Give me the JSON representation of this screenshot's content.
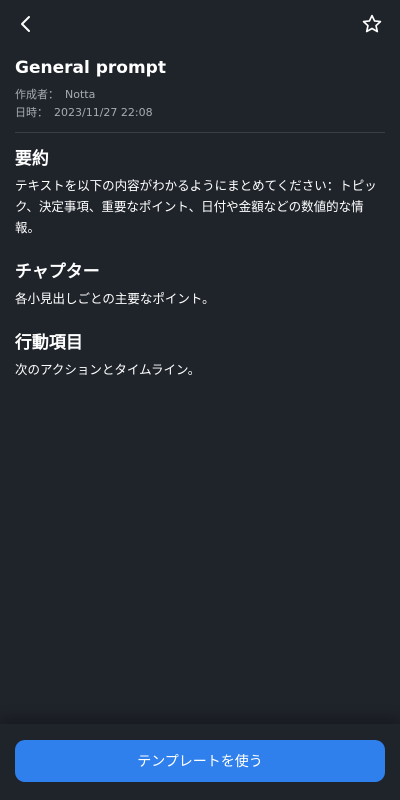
{
  "header": {
    "back_icon": "back-arrow-icon",
    "favorite_icon": "star-outline-icon"
  },
  "template": {
    "title": "General prompt",
    "author_label": "作成者：",
    "author_value": "Notta",
    "date_label": "日時：",
    "date_value": "2023/11/27 22:08"
  },
  "sections": [
    {
      "heading": "要約",
      "body": "テキストを以下の内容がわかるようにまとめてください：トピック、決定事項、重要なポイント、日付や金額などの数値的な情報。"
    },
    {
      "heading": "チャプター",
      "body": "各小見出しごとの主要なポイント。"
    },
    {
      "heading": "行動項目",
      "body": "次のアクションとタイムライン。"
    }
  ],
  "footer": {
    "use_template_label": "テンプレートを使う"
  },
  "colors": {
    "background": "#1f232a",
    "accent": "#2f80ed",
    "meta_text": "#a6abb3"
  }
}
